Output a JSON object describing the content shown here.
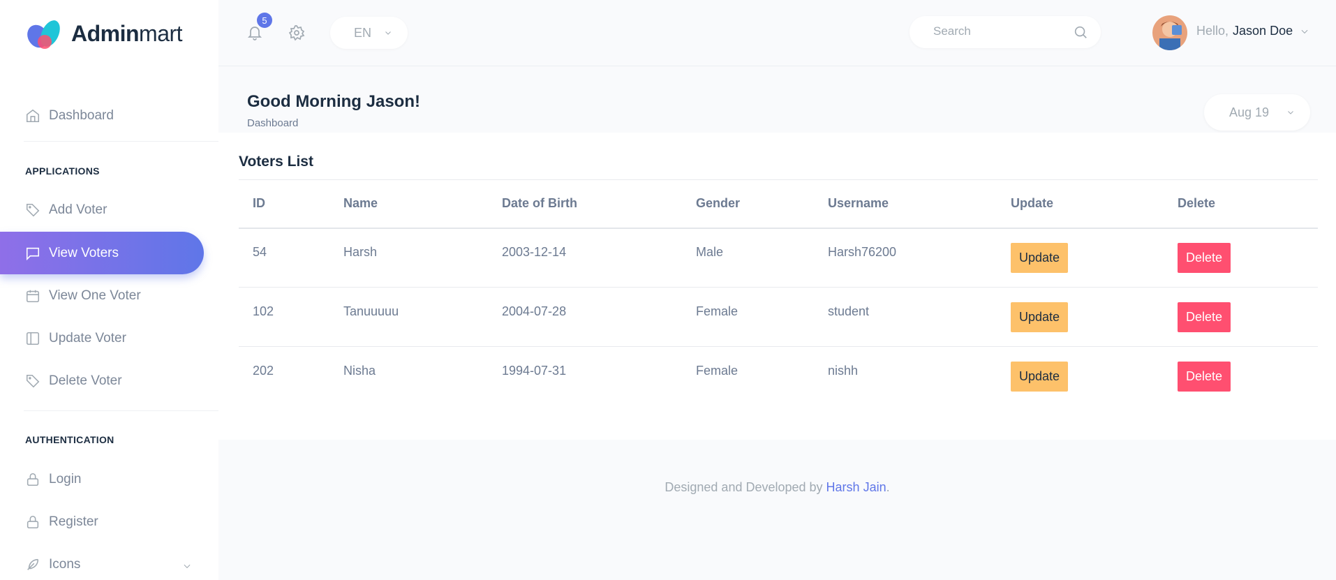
{
  "brand": {
    "name_bold": "Admin",
    "name_rest": "mart"
  },
  "sidebar": {
    "dashboard": "Dashboard",
    "sections": {
      "applications": "APPLICATIONS",
      "authentication": "AUTHENTICATION"
    },
    "items": [
      {
        "label": "Add Voter",
        "icon": "tag-icon"
      },
      {
        "label": "View Voters",
        "icon": "message-square-icon",
        "active": true
      },
      {
        "label": "View One Voter",
        "icon": "calendar-icon"
      },
      {
        "label": "Update Voter",
        "icon": "sidebar-layout-icon"
      },
      {
        "label": "Delete Voter",
        "icon": "tag-icon"
      }
    ],
    "auth_items": [
      {
        "label": "Login",
        "icon": "lock-icon"
      },
      {
        "label": "Register",
        "icon": "lock-icon"
      },
      {
        "label": "Icons",
        "icon": "feather-icon"
      }
    ]
  },
  "topbar": {
    "notification_count": "5",
    "language": "EN",
    "search_placeholder": "Search",
    "greeting": "Hello,",
    "user_name": "Jason Doe"
  },
  "page": {
    "title": "Good Morning Jason!",
    "breadcrumb": "Dashboard",
    "date_filter": "Aug 19"
  },
  "card": {
    "title": "Voters List",
    "columns": [
      "ID",
      "Name",
      "Date of Birth",
      "Gender",
      "Username",
      "Update",
      "Delete"
    ],
    "rows": [
      {
        "id": "54",
        "name": "Harsh",
        "dob": "2003-12-14",
        "gender": "Male",
        "username": "Harsh76200"
      },
      {
        "id": "102",
        "name": "Tanuuuuu",
        "dob": "2004-07-28",
        "gender": "Female",
        "username": "student"
      },
      {
        "id": "202",
        "name": "Nisha",
        "dob": "1994-07-31",
        "gender": "Female",
        "username": "nishh"
      }
    ],
    "update_label": "Update",
    "delete_label": "Delete"
  },
  "footer": {
    "text": "Designed and Developed by ",
    "author": "Harsh Jain",
    "suffix": "."
  },
  "colors": {
    "accent": "#5f76e8",
    "update_button": "#fdc16a",
    "delete_button": "#ff4f70"
  }
}
